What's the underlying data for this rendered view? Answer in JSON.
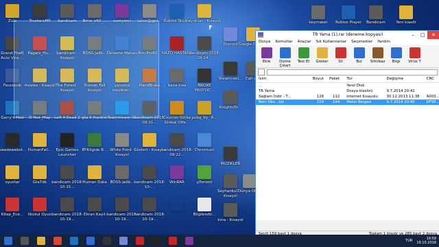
{
  "desktop": {
    "icons": [
      {
        "label": "Zula",
        "color": "#d3a62a"
      },
      {
        "label": "TruckersMP",
        "color": "#3c3c3c"
      },
      {
        "label": "bandicam",
        "color": "#5a5a5a"
      },
      {
        "label": "Bmw_e60_...",
        "color": "#6a6a6a"
      },
      {
        "label": "nemyemi",
        "color": "#7a3a9a"
      },
      {
        "label": "lakxc@gpz...",
        "color": "#8a8a8a"
      },
      {
        "label": "Roblox Studio",
        "color": "#1c5fb3"
      },
      {
        "label": "oyunlar - Kısayol",
        "color": "#e0b33a"
      },
      {
        "label": "Grand Theft Auto Vice ...",
        "color": "#444444"
      },
      {
        "label": "Pagani_Hu...",
        "color": "#cc3333"
      },
      {
        "label": "bandicam - Kısayol",
        "color": "#e0b33a"
      },
      {
        "label": "BOSS-Jailb...",
        "color": "#6a6a6a"
      },
      {
        "label": "Deneme Macası",
        "color": "#2d6fd0"
      },
      {
        "label": "BmcPro82...",
        "color": "#6a6a6a"
      },
      {
        "label": "NAZO HASTANE",
        "color": "#aa2222"
      },
      {
        "label": "bandicam 2018-09-24...",
        "color": "#4a4a4a"
      },
      {
        "label": "Facebook",
        "color": "#3b5998"
      },
      {
        "label": "movies - Kısayol",
        "color": "#e0b33a"
      },
      {
        "label": "The Forest - Kısayol",
        "color": "#e0b33a"
      },
      {
        "label": "Human Fall Kısayol",
        "color": "#e0b33a"
      },
      {
        "label": "yarışma müzikler...",
        "color": "#e0b33a"
      },
      {
        "label": "HandBrake",
        "color": "#cc6622"
      },
      {
        "label": "bana kısa",
        "color": "#6a6a6a"
      },
      {
        "label": "BROKE PROTOC...",
        "color": "#333333"
      },
      {
        "label": "Garry's Mod",
        "color": "#1e73be"
      },
      {
        "label": "D-Test_Map",
        "color": "#6a6a6a"
      },
      {
        "label": "Left 4 Dead 2",
        "color": "#aa3322"
      },
      {
        "label": "gta 5 franklin",
        "color": "#6a6a6a"
      },
      {
        "label": "TeamViewer 12",
        "color": "#0e8ee9"
      },
      {
        "label": "bandicam 2018-09-21...",
        "color": "#4a4a4a"
      },
      {
        "label": "Counter-Strike Global Offe...",
        "color": "#d08b1c"
      },
      {
        "label": "pubg_by_ 8...",
        "color": "#c9a227"
      },
      {
        "label": "Swedewebst...",
        "color": "#2a2a2a"
      },
      {
        "label": "HumanFall...",
        "color": "#e0b33a"
      },
      {
        "label": "Epic Games Launcher",
        "color": "#222222"
      },
      {
        "label": "BYKilgide B...",
        "color": "#3a7a3a"
      },
      {
        "label": "White Point - Kısayol",
        "color": "#888888"
      },
      {
        "label": "Gösteri - Kısayol",
        "color": "#e0b33a"
      },
      {
        "label": "bandicam 2018-09-22...",
        "color": "#4a4a4a"
      },
      {
        "label": "Chromium",
        "color": "#4a88d8"
      },
      {
        "label": "oyunlar",
        "color": "#e0b33a"
      },
      {
        "label": "GtaTdk",
        "color": "#e0b33a"
      },
      {
        "label": "bandicam 2018-10-15...",
        "color": "#4a4a4a"
      },
      {
        "label": "Human Data",
        "color": "#e0b33a"
      },
      {
        "label": "BOSS-Jailb...",
        "color": "#6a6a6a"
      },
      {
        "label": "bandicam 2018-10-...",
        "color": "#4a4a4a"
      },
      {
        "label": "WinRAR",
        "color": "#7a3a9a"
      },
      {
        "label": "µTorrent",
        "color": "#54a33a"
      },
      {
        "label": "Kitap_Ece...",
        "color": "#cc3333"
      },
      {
        "label": "İlkokul Oyun",
        "color": "#cc3333"
      },
      {
        "label": "bandicam 2018-10-19...",
        "color": "#4a4a4a"
      },
      {
        "label": "Ekran Kayıt",
        "color": "#4a4a4a"
      },
      {
        "label": "bandicam 2018-10-19...",
        "color": "#4a4a4a"
      },
      {
        "label": "bandicam 2018-10-19...",
        "color": "#4a4a4a"
      },
      {
        "label": "",
        "color": "rgba(0,0,0,0)"
      },
      {
        "label": "Bilgilendir...",
        "color": "#e8e8e8"
      }
    ],
    "right_icons": [
      {
        "label": "Discord",
        "color": "#7289da"
      },
      {
        "label": "Google Chrome",
        "color": "#e0b33a"
      },
      {
        "label": "keymaker",
        "color": "#6a6a6a"
      },
      {
        "label": "Roblox Player",
        "color": "#1c5fb3"
      },
      {
        "label": "Bandicam",
        "color": "#5a5a5a"
      },
      {
        "label": "Yeni klasör",
        "color": "#e0b33a"
      },
      {
        "label": "Steamcool...",
        "color": "#3a3a3a"
      },
      {
        "label": "Call of...",
        "color": "#5a5a5a"
      },
      {
        "label": "KnightsTo...",
        "color": "#5a5a5a"
      },
      {
        "label": "MÜZİKLER",
        "color": "#3a3a3a"
      },
      {
        "label": "Seyhankul... - Kısayol",
        "color": "#5a5a5a"
      },
      {
        "label": "Dünya Ölç...",
        "color": "#8a8a8a"
      },
      {
        "label": "kına - Kısayol",
        "color": "#5a5a5a"
      }
    ]
  },
  "winrar": {
    "title": "TR Yama (1).rar (deneme kopyası)",
    "menu": [
      "Dosya",
      "Komutlar",
      "Araçlar",
      "Sık Kullanılanlar",
      "Seçenekler",
      "Yardım"
    ],
    "toolbar": [
      {
        "label": "Ekle",
        "color": "#7a3a9a"
      },
      {
        "label": "Dizine Çıkart",
        "color": "#2d6fd0"
      },
      {
        "label": "Test Et",
        "color": "#3a9a3a"
      },
      {
        "label": "Göster",
        "color": "#e0b33a"
      },
      {
        "label": "Sil",
        "color": "#cc3333"
      },
      {
        "label": "Bul",
        "color": "#2d6fd0"
      },
      {
        "label": "Sihirbaz",
        "color": "#8a5a2a"
      },
      {
        "label": "Bilgi",
        "color": "#2d6fd0"
      },
      {
        "label": "Virüs T",
        "color": "#cc3333"
      }
    ],
    "columns": {
      "name": "İsim",
      "size": "Boyut",
      "packed": "Paket",
      "type": "Tür",
      "modified": "Değişme",
      "crc": "CRC"
    },
    "rows": [
      {
        "name": "..",
        "size": "",
        "packed": "",
        "type": "Yerel Disk",
        "modified": "",
        "crc": "",
        "selected": false
      },
      {
        "name": "TR Yama",
        "size": "",
        "packed": "",
        "type": "Dosya klasörü",
        "modified": "9.7.2014 20:41",
        "crc": "",
        "selected": false
      },
      {
        "name": "Sağlam İndir - T...",
        "size": "126",
        "packed": "112",
        "type": "Internet Kısayolu",
        "modified": "30.12.2013 11:38",
        "crc": "A003...",
        "selected": false
      },
      {
        "name": "Beni Oku ..txt",
        "size": "159",
        "packed": "144",
        "type": "Metin Belgesi",
        "modified": "9.7.2014 20:45",
        "crc": "DF5E...",
        "selected": true
      }
    ],
    "status_left": "Seçili 159 bayt 1 dosya",
    "status_right": "Toplam 1 klasör ve 285 bayt 2 dosya"
  },
  "taskbar": {
    "buttons": [
      {
        "name": "start",
        "color": "#2d6fd0"
      },
      {
        "name": "search",
        "color": "#555555"
      },
      {
        "name": "file-explorer",
        "color": "#e0b33a"
      },
      {
        "name": "chrome",
        "color": "#dd4433"
      },
      {
        "name": "edge",
        "color": "#1e73be"
      },
      {
        "name": "store",
        "color": "#2d6fd0"
      },
      {
        "name": "steam",
        "color": "#333333"
      },
      {
        "name": "discord",
        "color": "#7289da"
      },
      {
        "name": "opera",
        "color": "#cc2222"
      },
      {
        "name": "bandicam",
        "color": "#222222"
      },
      {
        "name": "record",
        "color": "#cc2222"
      },
      {
        "name": "winrar",
        "color": "#7a3a9a"
      }
    ],
    "lang": "TUR",
    "time": "19:59",
    "date": "19.10.2018"
  }
}
